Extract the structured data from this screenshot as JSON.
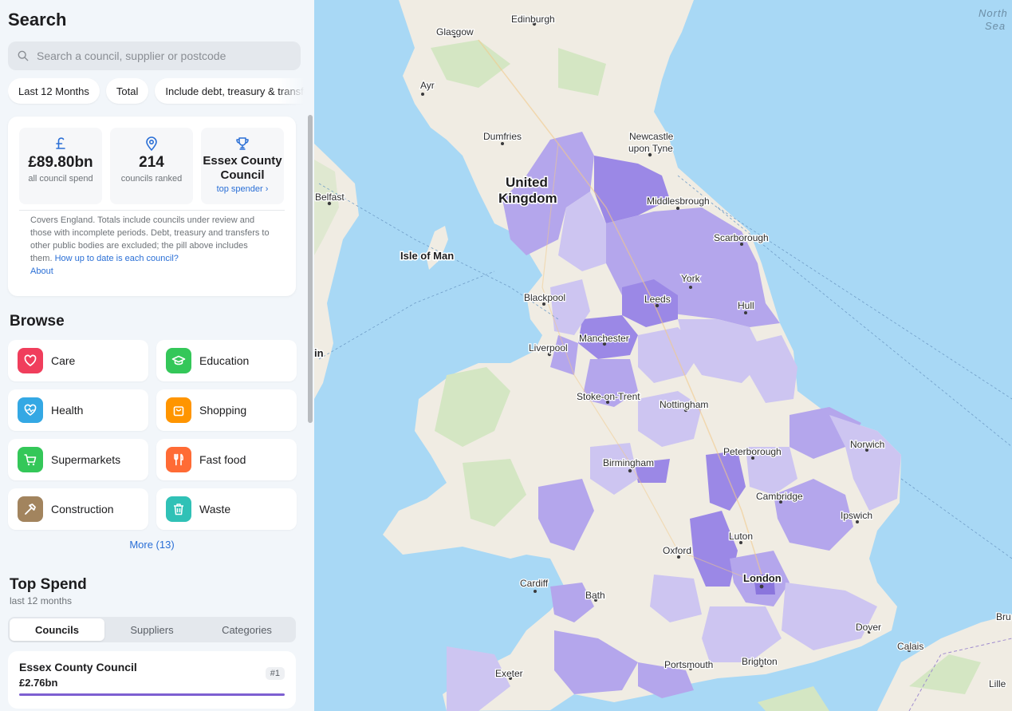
{
  "sidebar": {
    "title": "Search",
    "search_placeholder": "Search a council, supplier or postcode",
    "filters": [
      "Last 12 Months",
      "Total",
      "Include debt, treasury & transfers"
    ],
    "stats": {
      "spend_value": "£89.80bn",
      "spend_label": "all council spend",
      "councils_value": "214",
      "councils_label": "councils ranked",
      "top_name": "Essex County Council",
      "top_link": "top spender ›",
      "note": "Covers England. Totals include councils under review and those with incomplete periods. Debt, treasury and transfers to other public bodies are excluded; the pill above includes them.",
      "note_link": "How up to date is each council?",
      "about_link": "About"
    },
    "browse": {
      "title": "Browse",
      "items": [
        {
          "label": "Care",
          "icon": "heart-icon",
          "color": "#f03e5c"
        },
        {
          "label": "Education",
          "icon": "graduation-cap-icon",
          "color": "#34c759"
        },
        {
          "label": "Health",
          "icon": "heart-pulse-icon",
          "color": "#34a8e4"
        },
        {
          "label": "Shopping",
          "icon": "shopping-bag-icon",
          "color": "#ff9500"
        },
        {
          "label": "Supermarkets",
          "icon": "cart-icon",
          "color": "#34c759"
        },
        {
          "label": "Fast food",
          "icon": "fork-knife-icon",
          "color": "#ff6b35"
        },
        {
          "label": "Construction",
          "icon": "hammer-icon",
          "color": "#a2845e"
        },
        {
          "label": "Waste",
          "icon": "trash-icon",
          "color": "#30c1b6"
        }
      ],
      "more": "More (13)"
    },
    "top_spend": {
      "title": "Top Spend",
      "subtitle": "last 12 months",
      "tabs": [
        "Councils",
        "Suppliers",
        "Categories"
      ],
      "active_tab": "Councils",
      "first": {
        "name": "Essex County Council",
        "value": "£2.76bn",
        "rank": "#1"
      }
    }
  },
  "map": {
    "labels": {
      "edinburgh": "Edinburgh",
      "glasgow": "Glasgow",
      "ayr": "Ayr",
      "dumfries": "Dumfries",
      "newcastle1": "Newcastle",
      "newcastle2": "upon Tyne",
      "uk1": "United",
      "uk2": "Kingdom",
      "belfast": "Belfast",
      "middlesbrough": "Middlesbrough",
      "scarborough": "Scarborough",
      "isle_of_man": "Isle of Man",
      "york": "York",
      "blackpool": "Blackpool",
      "leeds": "Leeds",
      "hull": "Hull",
      "manchester": "Manchester",
      "liverpool": "Liverpool",
      "stoke": "Stoke-on-Trent",
      "nottingham": "Nottingham",
      "norwich": "Norwich",
      "peterborough": "Peterborough",
      "birmingham": "Birmingham",
      "cambridge": "Cambridge",
      "ipswich": "Ipswich",
      "luton": "Luton",
      "oxford": "Oxford",
      "london": "London",
      "cardiff": "Cardiff",
      "bath": "Bath",
      "dover": "Dover",
      "calais": "Calais",
      "exeter": "Exeter",
      "portsmouth": "Portsmouth",
      "brighton": "Brighton",
      "lille": "Lille",
      "bru": "Bru",
      "dublin_fragment": "in",
      "north1": "North",
      "north2": "Sea"
    },
    "colors": {
      "sea": "#a8d8f5",
      "land": "#f0ece3",
      "green": "#d4e6c3",
      "purple_dark": "#9b88e6",
      "purple_mid": "#b4a6ec",
      "purple_light": "#cdc5f1"
    }
  }
}
